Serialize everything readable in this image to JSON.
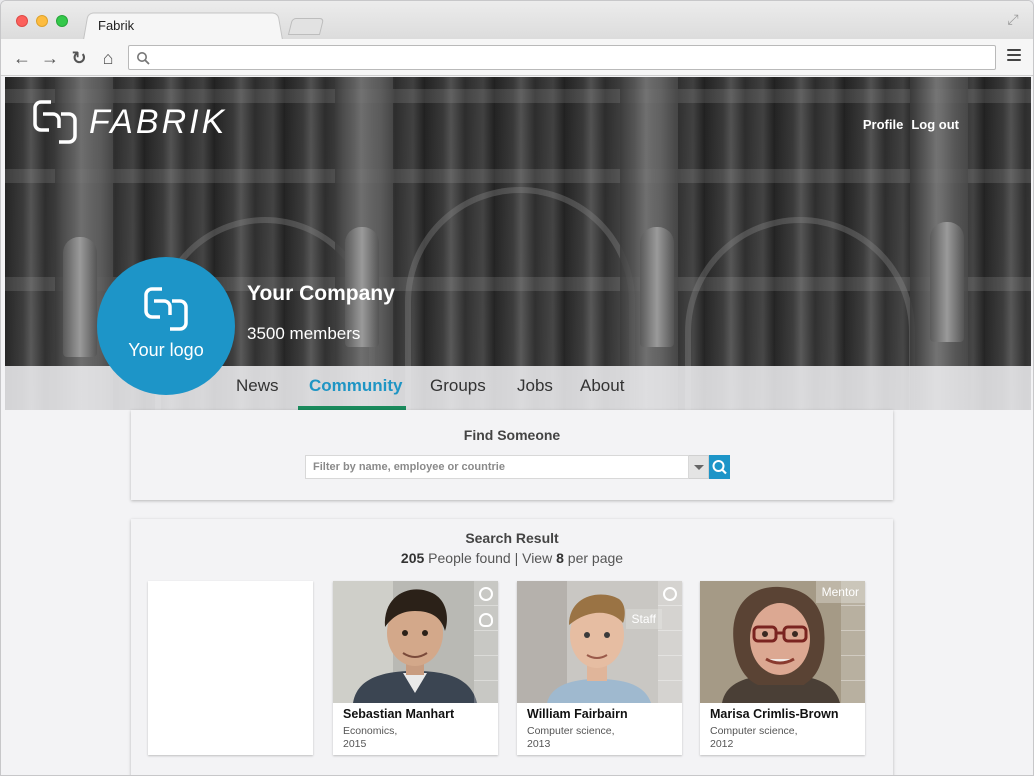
{
  "browser": {
    "tab_title": "Fabrik",
    "url": ""
  },
  "site": {
    "logo_text": "FABRIK",
    "top_links": [
      "Profile",
      "Log out"
    ]
  },
  "company": {
    "name": "Your Company",
    "members": "3500 members",
    "logo_label": "Your logo"
  },
  "nav": {
    "items": [
      "News",
      "Community",
      "Groups",
      "Jobs",
      "About"
    ],
    "active": "Community"
  },
  "find": {
    "title": "Find Someone",
    "placeholder": "Filter by name, employee or countrie"
  },
  "results": {
    "title": "Search Result",
    "count": "205",
    "count_label": "People found | View",
    "per_page": "8",
    "per_page_label": "per page",
    "people": [
      {
        "name": "Sebastian Manhart",
        "field": "Economics,",
        "year": "2015",
        "badge": ""
      },
      {
        "name": "William Fairbairn",
        "field": "Computer science,",
        "year": "2013",
        "badge": "Staff"
      },
      {
        "name": "Marisa Crimlis-Brown",
        "field": "Computer science,",
        "year": "2012",
        "badge": "Mentor"
      }
    ]
  },
  "colors": {
    "accent": "#1d95c8",
    "active_underline": "#1a8a5c"
  }
}
